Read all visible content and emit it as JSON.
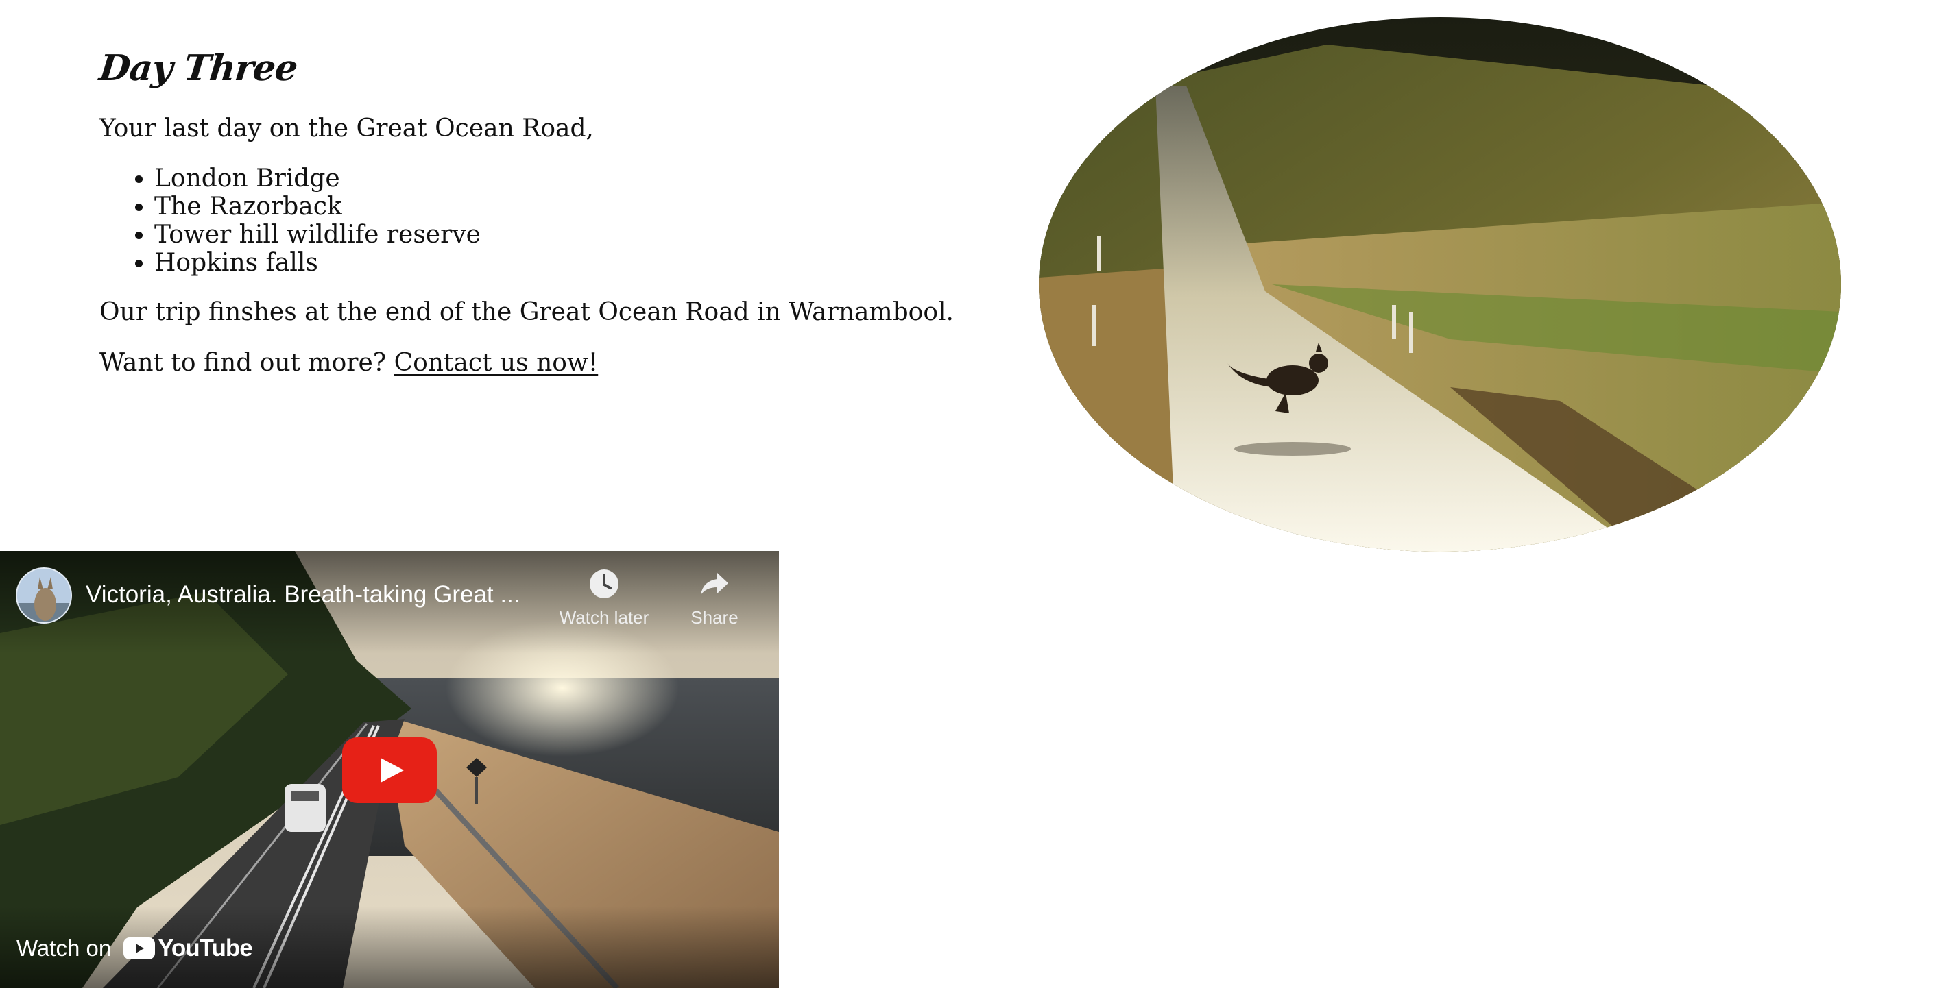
{
  "section": {
    "title": "Day Three",
    "intro": "Your last day on the Great Ocean Road,",
    "places": [
      "London Bridge",
      "The Razorback",
      "Tower hill wildlife reserve",
      "Hopkins falls"
    ],
    "conclusion": "Our trip finshes at the end of the Great Ocean Road in Warnambool.",
    "cta_prefix": "Want to find out more?",
    "cta_link": "Contact us now!"
  },
  "video": {
    "title": "Victoria, Australia. Breath-taking Great ...",
    "watch_later_label": "Watch later",
    "share_label": "Share",
    "watch_on_label": "Watch on",
    "youtube_label": "YouTube"
  },
  "icons": {
    "watch_later": "clock-icon",
    "share": "share-arrow-icon",
    "play": "play-icon",
    "youtube": "youtube-logo-icon"
  },
  "colors": {
    "play_button": "#e62117",
    "text": "#111111",
    "background": "#ffffff"
  }
}
